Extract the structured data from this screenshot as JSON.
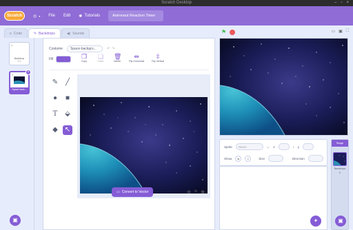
{
  "window": {
    "title": "Scratch Desktop",
    "controls": [
      "–",
      "▫",
      "×"
    ]
  },
  "menubar": {
    "logo": "Scratch",
    "globe_icon": "globe-icon",
    "file": "File",
    "edit": "Edit",
    "tutorials": "Tutorials",
    "project_title": "Astronaut Reaction Timer"
  },
  "tabs": [
    {
      "label": "Code",
      "icon": "code-icon"
    },
    {
      "label": "Backdrops",
      "icon": "brush-icon"
    },
    {
      "label": "Sounds",
      "icon": "speaker-icon"
    }
  ],
  "backdrop_list": {
    "items": [
      {
        "num": "1",
        "label": "Backdrop",
        "size": "2x2"
      },
      {
        "num": "2",
        "label": "Space back...",
        "size": "480 x 360"
      }
    ]
  },
  "editor": {
    "costume_label": "Costume",
    "costume_name": "Space-backgro...",
    "fill_label": "Fill",
    "fill_color": "#855cd6",
    "buttons": [
      "Copy",
      "Paste",
      "Delete",
      "Flip Horizontal",
      "Flip Vertical"
    ],
    "convert_label": "Convert to Vector"
  },
  "sprite_info": {
    "sprite_label": "Sprite",
    "sprite_value": "Name",
    "x_label": "x",
    "y_label": "y",
    "show_label": "Show",
    "size_label": "Size",
    "direction_label": "Direction"
  },
  "stage_panel": {
    "header": "Stage",
    "backdrops_label": "Backdrops",
    "backdrops_count": "2"
  },
  "colors": {
    "accent": "#855cd6",
    "menubar": "#8f6cd6",
    "flag": "#4cbf56",
    "stop": "#ec5959"
  }
}
